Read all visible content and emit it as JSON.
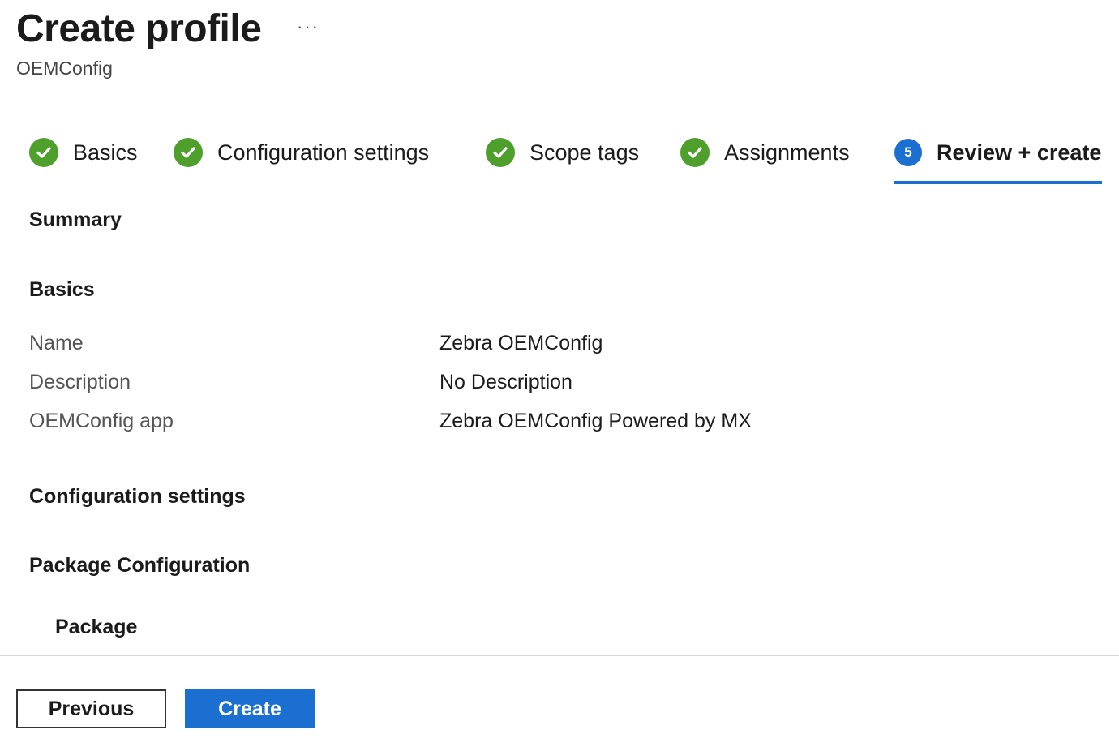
{
  "header": {
    "title": "Create profile",
    "more_label": "···",
    "subtitle": "OEMConfig"
  },
  "wizard": {
    "tabs": [
      {
        "label": "Basics",
        "state": "complete",
        "icon": "check-circle-icon"
      },
      {
        "label": "Configuration settings",
        "state": "complete",
        "icon": "check-circle-icon"
      },
      {
        "label": "Scope tags",
        "state": "complete",
        "icon": "check-circle-icon"
      },
      {
        "label": "Assignments",
        "state": "complete",
        "icon": "check-circle-icon"
      },
      {
        "label": "Review + create",
        "state": "current",
        "step_number": "5"
      }
    ],
    "accent_color": "#1a6fd0",
    "complete_color": "#4f9f2c"
  },
  "summary": {
    "heading": "Summary",
    "basics": {
      "heading": "Basics",
      "rows": [
        {
          "label": "Name",
          "value": "Zebra OEMConfig"
        },
        {
          "label": "Description",
          "value": "No Description"
        },
        {
          "label": "OEMConfig app",
          "value": "Zebra OEMConfig Powered by MX"
        }
      ]
    },
    "configuration": {
      "heading": "Configuration settings",
      "package_configuration_heading": "Package Configuration",
      "package_heading": "Package"
    }
  },
  "footer": {
    "previous_label": "Previous",
    "create_label": "Create"
  }
}
